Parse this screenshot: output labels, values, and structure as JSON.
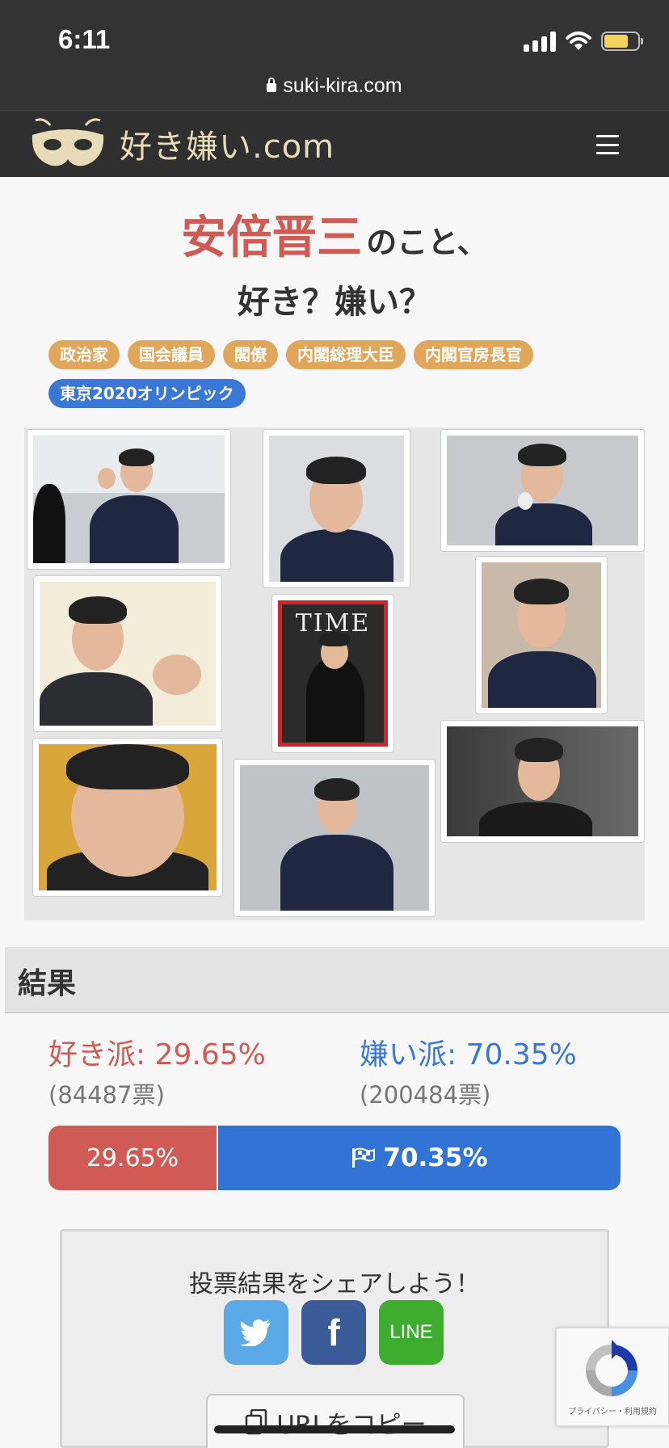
{
  "status_bar": {
    "time": "6:11"
  },
  "browser": {
    "url": "suki-kira.com"
  },
  "site": {
    "logo_text": "好き嫌い.com"
  },
  "page": {
    "title_name": "安倍晋三",
    "title_suffix": "のこと、",
    "question": "好き？嫌い？",
    "tags": [
      "政治家",
      "国会議員",
      "閣僚",
      "内閣総理大臣",
      "内閣官房長官"
    ],
    "tag_special": "東京2020オリンピック",
    "photo_texts": {
      "magazine": "TIME"
    }
  },
  "results": {
    "heading": "結果",
    "like_label": "好き派: 29.65%",
    "like_votes": "(84487票)",
    "dislike_label": "嫌い派: 70.35%",
    "dislike_votes": "(200484票)",
    "like_share": 29.65,
    "dislike_share": 70.35,
    "bar_like_text": "29.65%",
    "bar_dislike_text": "70.35%"
  },
  "share": {
    "heading": "投票結果をシェアしよう！",
    "facebook": "f",
    "line": "LINE",
    "copy_url": "URLをコピー"
  },
  "recaptcha": {
    "links": "プライバシー・利用規約"
  },
  "colors": {
    "like": "#cf5b54",
    "dislike": "#3273d6",
    "tag": "#e0a65a",
    "tag_special": "#3a78d8",
    "header": "#2f2f2f"
  }
}
